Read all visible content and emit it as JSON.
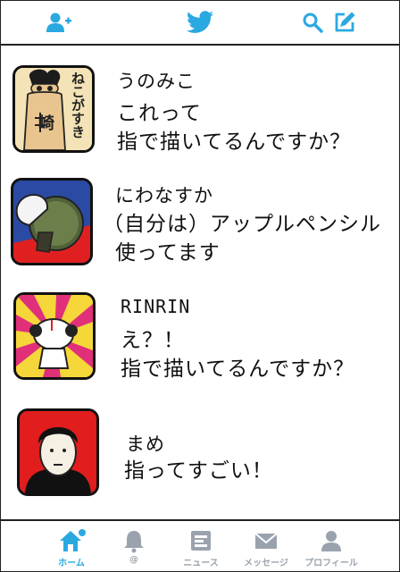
{
  "colors": {
    "accent": "#2aa9e0",
    "inactive": "#9aa3ad",
    "border": "#222222"
  },
  "header": {
    "left_icon": "add-user-icon",
    "center_icon": "twitter-bird-icon",
    "right_icons": [
      "search-icon",
      "compose-tweet-icon"
    ]
  },
  "tweets": [
    {
      "name": "うのみこ",
      "lines": [
        "これって",
        "指で描いてるんですか？"
      ]
    },
    {
      "name": "にわなすか",
      "lines": [
        "（自分は）アップルペンシル",
        "使ってます"
      ]
    },
    {
      "name": "RINRIN",
      "lines": [
        "え？！",
        "指で描いてるんですか？"
      ]
    },
    {
      "name": "まめ",
      "lines": [
        "指ってすごい！"
      ]
    }
  ],
  "avatar_texts": {
    "unomiko": "ねこがすき",
    "unomiko_sub": "崎"
  },
  "tabs": [
    {
      "label": "ホーム",
      "icon": "home-icon",
      "active": true
    },
    {
      "label": "@",
      "icon": "notifications-bell-icon",
      "active": false
    },
    {
      "label": "ニュース",
      "icon": "news-icon",
      "active": false
    },
    {
      "label": "メッセージ",
      "icon": "messages-envelope-icon",
      "active": false
    },
    {
      "label": "プロフィール",
      "icon": "profile-icon",
      "active": false
    }
  ]
}
